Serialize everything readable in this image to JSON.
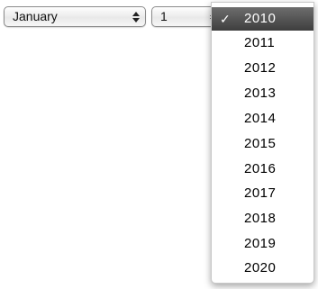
{
  "month_select": {
    "value": "January",
    "icon": "updown-arrows-icon"
  },
  "day_select": {
    "value": "1",
    "icon": "updown-arrows-icon"
  },
  "year_menu": {
    "check_mark": "✓",
    "selected": "2010",
    "options": [
      "2010",
      "2011",
      "2012",
      "2013",
      "2014",
      "2015",
      "2016",
      "2017",
      "2018",
      "2019",
      "2020"
    ]
  }
}
